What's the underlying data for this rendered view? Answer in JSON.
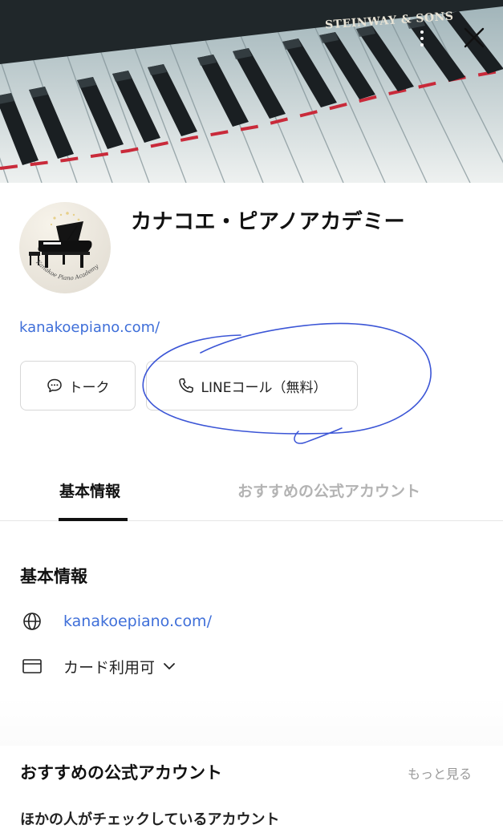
{
  "cover": {
    "brand_text": "STEINWAY & SONS",
    "more_icon": "kebab-menu-icon",
    "close_icon": "close-icon"
  },
  "profile": {
    "name": "カナコエ・ピアノアカデミー",
    "avatar_caption": "Kanakoe Piano Academy",
    "website": "kanakoepiano.com/"
  },
  "actions": {
    "talk_label": "トーク",
    "talk_icon": "chat-bubble-icon",
    "call_label": "LINEコール（無料）",
    "call_icon": "phone-icon"
  },
  "tabs": [
    {
      "label": "基本情報",
      "active": true
    },
    {
      "label": "おすすめの公式アカウント",
      "active": false
    }
  ],
  "basic_info": {
    "title": "基本情報",
    "website": "kanakoepiano.com/",
    "website_icon": "globe-icon",
    "payment": "カード利用可",
    "payment_icon": "card-icon"
  },
  "recommended": {
    "title": "おすすめの公式アカウント",
    "more_label": "もっと見る",
    "subtitle": "ほかの人がチェックしているアカウント"
  },
  "colors": {
    "link": "#3f6fd9",
    "annotation": "#3b55d6",
    "inactive_tab": "#b3b3b3"
  }
}
